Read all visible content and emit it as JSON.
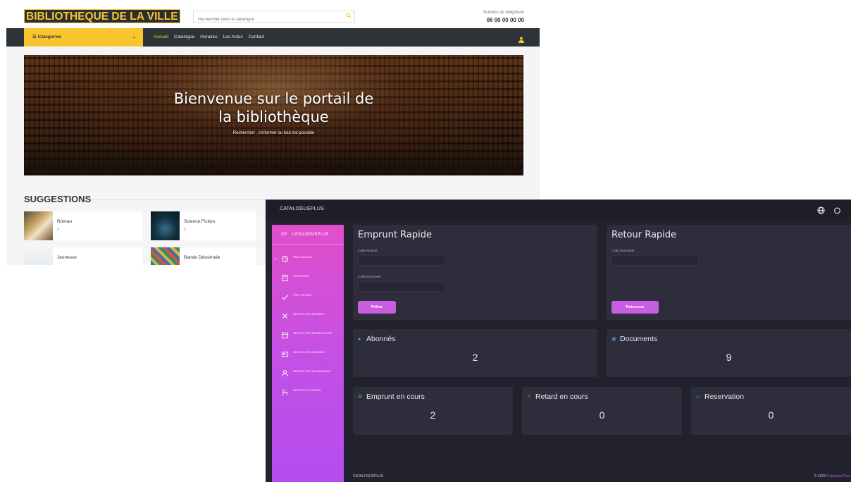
{
  "portal": {
    "logo": "BIBLIOTHEQUE DE LA VILLE",
    "search_placeholder": "Rechercher dans le catalogue",
    "phone_label": "Numéro de téléphone",
    "phone": "06 00 00 00 00",
    "categories_label": "☰ Categories",
    "menu": [
      "Accueil",
      "Catalogue",
      "Horaires",
      "Les Actus",
      "Contact"
    ],
    "hero_title_line1": "Bienvenue sur le portail de",
    "hero_title_line2": "la bibliothèque",
    "hero_subtitle": "Rechercher , s'informer ou tout est possible",
    "suggestions_heading": "SUGGESTIONS",
    "suggestions": [
      {
        "title": "Roman",
        "count": "4"
      },
      {
        "title": "Science Fiction",
        "count": "5"
      },
      {
        "title": "Jeunesse",
        "count": ""
      },
      {
        "title": "Bande Déssinnée",
        "count": ""
      }
    ],
    "colors": {
      "accent": "#f7c62f",
      "nav": "#2e3338"
    }
  },
  "admin": {
    "brand": "CATALOGUEPLUS",
    "sidebar": {
      "logo_short": "CP",
      "logo_name": "CATALOGUEPLUS",
      "items": [
        {
          "label": "PAGE ACCUEIL",
          "icon": "dashboard-icon"
        },
        {
          "label": "INVENTAIRE",
          "icon": "inventory-icon"
        },
        {
          "label": "PRET RETOUR",
          "icon": "check-icon"
        },
        {
          "label": "GESTION DES RETARDS",
          "icon": "cross-icon"
        },
        {
          "label": "GESTION DES RESERVATIONS",
          "icon": "calendar-icon"
        },
        {
          "label": "GESTION DES ABONNÉS",
          "icon": "id-card-icon"
        },
        {
          "label": "GESTION DES UTILISATEURS",
          "icon": "user-icon"
        },
        {
          "label": "GESTION DU PORTAIL",
          "icon": "portal-icon"
        }
      ]
    },
    "emprunt": {
      "title": "Emprunt Rapide",
      "field1_label": "Carte Abonné",
      "field2_label": "Code Document",
      "button": "Prêter"
    },
    "retour": {
      "title": "Retour Rapide",
      "field1_label": "Code Document",
      "button": "Retourner"
    },
    "stats": {
      "abonnes": {
        "label": "Abonnés",
        "value": "2"
      },
      "documents": {
        "label": "Documents",
        "value": "9"
      },
      "emprunts": {
        "label": "Emprunt en cours",
        "value": "2"
      },
      "retards": {
        "label": "Retard en cours",
        "value": "0"
      },
      "reservations": {
        "label": "Reservation",
        "value": "0"
      }
    },
    "footer_left": "CATALOGUEPLUS",
    "footer_right_prefix": "© 2023",
    "footer_right_brand": "CataloguePlus",
    "colors": {
      "sidebar_top": "#e14ecb",
      "sidebar_bottom": "#b54cf0",
      "button": "#c95de0",
      "panel": "#2d2d3c",
      "background": "#22222e"
    }
  }
}
